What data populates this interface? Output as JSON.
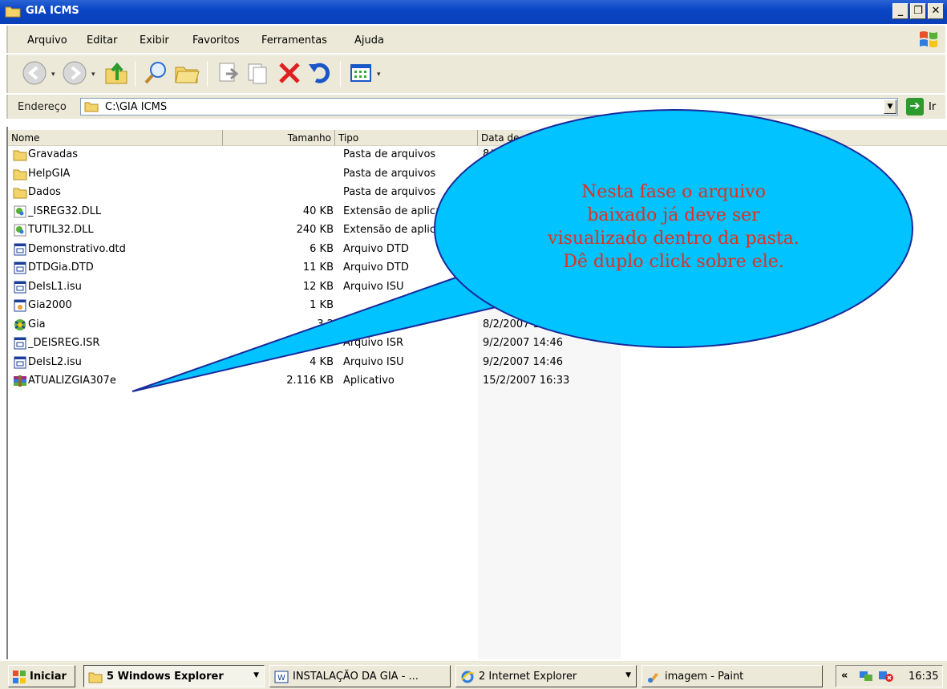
{
  "window": {
    "title": "GIA ICMS"
  },
  "menu": [
    "Arquivo",
    "Editar",
    "Exibir",
    "Favoritos",
    "Ferramentas",
    "Ajuda"
  ],
  "address": {
    "label": "Endereço",
    "path": "C:\\GIA ICMS",
    "go_label": "Ir"
  },
  "columns": [
    "Nome",
    "Tamanho",
    "Tipo",
    "Data de modificação"
  ],
  "files": [
    {
      "name": "Gravadas",
      "size": "",
      "type": "Pasta de arquivos",
      "date": "8/1",
      "icon": "folder-icon"
    },
    {
      "name": "HelpGIA",
      "size": "",
      "type": "Pasta de arquivos",
      "date": "",
      "icon": "folder-icon"
    },
    {
      "name": "Dados",
      "size": "",
      "type": "Pasta de arquivos",
      "date": "",
      "icon": "folder-icon"
    },
    {
      "name": "_ISREG32.DLL",
      "size": "40 KB",
      "type": "Extensão de aplica",
      "date": "",
      "icon": "dll-icon"
    },
    {
      "name": "TUTIL32.DLL",
      "size": "240 KB",
      "type": "Extensão de aplica",
      "date": "",
      "icon": "dll-icon"
    },
    {
      "name": "Demonstrativo.dtd",
      "size": "6 KB",
      "type": "Arquivo DTD",
      "date": "",
      "icon": "document-icon"
    },
    {
      "name": "DTDGia.DTD",
      "size": "11 KB",
      "type": "Arquivo DTD",
      "date": "",
      "icon": "document-icon"
    },
    {
      "name": "DeIsL1.isu",
      "size": "12 KB",
      "type": "Arquivo ISU",
      "date": "",
      "icon": "document-icon"
    },
    {
      "name": "Gia2000",
      "size": "1 KB",
      "type": "",
      "date": "27/12/",
      "icon": "settings-file-icon"
    },
    {
      "name": "Gia",
      "size": "3.2",
      "type": "Aplicativo",
      "date": "8/2/2007 14:31",
      "icon": "application-icon"
    },
    {
      "name": "_DEISREG.ISR",
      "size": "1 KB",
      "type": "Arquivo ISR",
      "date": "9/2/2007 14:46",
      "icon": "document-icon"
    },
    {
      "name": "DeIsL2.isu",
      "size": "4 KB",
      "type": "Arquivo ISU",
      "date": "9/2/2007 14:46",
      "icon": "document-icon"
    },
    {
      "name": "ATUALIZGIA307e",
      "size": "2.116 KB",
      "type": "Aplicativo",
      "date": "15/2/2007 16:33",
      "icon": "winrar-icon"
    }
  ],
  "callout": {
    "lines": [
      "Nesta fase o arquivo",
      "baixado já deve ser",
      "visualizado dentro da pasta.",
      "Dê duplo click sobre ele."
    ]
  },
  "taskbar": {
    "start_label": "Iniciar",
    "tasks": [
      {
        "label": "5 Windows Explorer",
        "icon": "folder-icon",
        "active": true,
        "dropdown": true
      },
      {
        "label": "INSTALAÇÃO DA GIA - ...",
        "icon": "word-icon",
        "active": false,
        "dropdown": false
      },
      {
        "label": "2 Internet Explorer",
        "icon": "ie-icon",
        "active": false,
        "dropdown": true
      },
      {
        "label": "imagem - Paint",
        "icon": "paint-icon",
        "active": false,
        "dropdown": false
      }
    ],
    "clock": "16:35"
  }
}
